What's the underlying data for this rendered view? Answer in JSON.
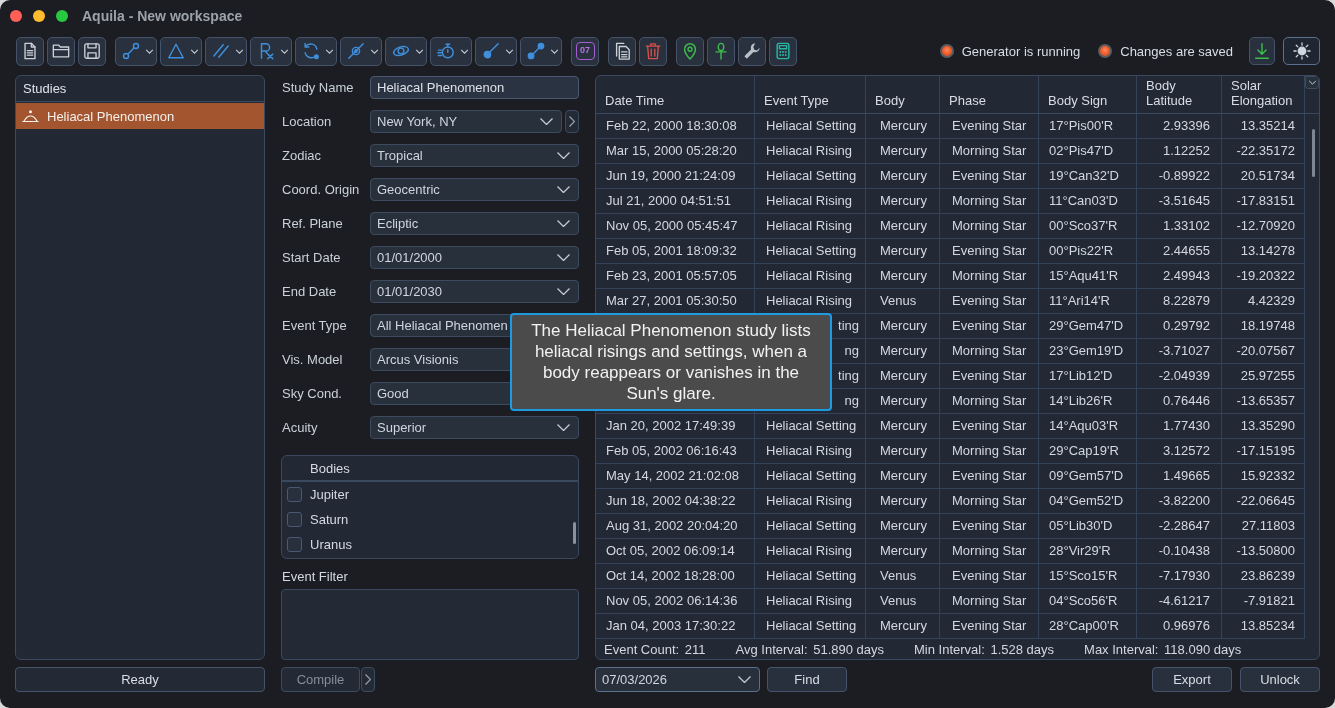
{
  "window": {
    "title": "Aquila - New workspace"
  },
  "toolbar": {
    "calendar_day": "07",
    "statuses": [
      {
        "label": "Generator is running"
      },
      {
        "label": "Changes are saved"
      }
    ]
  },
  "studies": {
    "title": "Studies",
    "items": [
      {
        "label": "Heliacal Phenomenon",
        "selected": true
      }
    ],
    "status": "Ready"
  },
  "form": {
    "fields": [
      {
        "label": "Study Name",
        "value": "Heliacal Phenomenon",
        "kind": "text"
      },
      {
        "label": "Location",
        "value": "New York, NY",
        "kind": "dropdown-link"
      },
      {
        "label": "Zodiac",
        "value": "Tropical",
        "kind": "dropdown"
      },
      {
        "label": "Coord. Origin",
        "value": "Geocentric",
        "kind": "dropdown"
      },
      {
        "label": "Ref. Plane",
        "value": "Ecliptic",
        "kind": "dropdown"
      },
      {
        "label": "Start Date",
        "value": "01/01/2000",
        "kind": "dropdown"
      },
      {
        "label": "End Date",
        "value": "01/01/2030",
        "kind": "dropdown"
      },
      {
        "label": "Event Type",
        "value": "All Heliacal Phenomen",
        "kind": "obscured"
      },
      {
        "label": "Vis. Model",
        "value": "Arcus Visionis",
        "kind": "obscured"
      },
      {
        "label": "Sky Cond.",
        "value": "Good",
        "kind": "obscured"
      },
      {
        "label": "Acuity",
        "value": "Superior",
        "kind": "dropdown"
      }
    ]
  },
  "bodies": {
    "title": "Bodies",
    "items": [
      {
        "label": "Jupiter",
        "checked": false
      },
      {
        "label": "Saturn",
        "checked": false
      },
      {
        "label": "Uranus",
        "checked": false
      }
    ]
  },
  "event_filter": {
    "label": "Event Filter"
  },
  "compile_button": {
    "label": "Compile",
    "disabled": true
  },
  "table": {
    "columns": [
      "Date Time",
      "Event Type",
      "Body",
      "Phase",
      "Body Sign",
      "Body Latitude",
      "Solar Elongation"
    ],
    "rows": [
      {
        "date_time": "Feb 22, 2000 18:30:08",
        "event_type": "Heliacal Setting",
        "body": "Mercury",
        "phase": "Evening Star",
        "body_sign": "17°Pis00'R",
        "body_latitude": "2.93396",
        "solar_elongation": "13.35214",
        "under_tooltip": false
      },
      {
        "date_time": "Mar 15, 2000 05:28:20",
        "event_type": "Heliacal Rising",
        "body": "Mercury",
        "phase": "Morning Star",
        "body_sign": "02°Pis47'D",
        "body_latitude": "1.12252",
        "solar_elongation": "-22.35172",
        "under_tooltip": false
      },
      {
        "date_time": "Jun 19, 2000 21:24:09",
        "event_type": "Heliacal Setting",
        "body": "Mercury",
        "phase": "Evening Star",
        "body_sign": "19°Can32'D",
        "body_latitude": "-0.89922",
        "solar_elongation": "20.51734",
        "under_tooltip": false
      },
      {
        "date_time": "Jul 21, 2000 04:51:51",
        "event_type": "Heliacal Rising",
        "body": "Mercury",
        "phase": "Morning Star",
        "body_sign": "11°Can03'D",
        "body_latitude": "-3.51645",
        "solar_elongation": "-17.83151",
        "under_tooltip": false
      },
      {
        "date_time": "Nov 05, 2000 05:45:47",
        "event_type": "Heliacal Rising",
        "body": "Mercury",
        "phase": "Morning Star",
        "body_sign": "00°Sco37'R",
        "body_latitude": "1.33102",
        "solar_elongation": "-12.70920",
        "under_tooltip": false
      },
      {
        "date_time": "Feb 05, 2001 18:09:32",
        "event_type": "Heliacal Setting",
        "body": "Mercury",
        "phase": "Evening Star",
        "body_sign": "00°Pis22'R",
        "body_latitude": "2.44655",
        "solar_elongation": "13.14278",
        "under_tooltip": false
      },
      {
        "date_time": "Feb 23, 2001 05:57:05",
        "event_type": "Heliacal Rising",
        "body": "Mercury",
        "phase": "Morning Star",
        "body_sign": "15°Aqu41'R",
        "body_latitude": "2.49943",
        "solar_elongation": "-19.20322",
        "under_tooltip": false
      },
      {
        "date_time": "Mar 27, 2001 05:30:50",
        "event_type": "Heliacal Rising",
        "body": "Venus",
        "phase": "Evening Star",
        "body_sign": "11°Ari14'R",
        "body_latitude": "8.22879",
        "solar_elongation": "4.42329",
        "under_tooltip": false
      },
      {
        "event_type": "ting",
        "body": "Mercury",
        "phase": "Evening Star",
        "body_sign": "29°Gem47'D",
        "body_latitude": "0.29792",
        "solar_elongation": "18.19748",
        "under_tooltip": true
      },
      {
        "event_type": "ng",
        "body": "Mercury",
        "phase": "Morning Star",
        "body_sign": "23°Gem19'D",
        "body_latitude": "-3.71027",
        "solar_elongation": "-20.07567",
        "under_tooltip": true
      },
      {
        "event_type": "ting",
        "body": "Mercury",
        "phase": "Evening Star",
        "body_sign": "17°Lib12'D",
        "body_latitude": "-2.04939",
        "solar_elongation": "25.97255",
        "under_tooltip": true
      },
      {
        "event_type": "ng",
        "body": "Mercury",
        "phase": "Morning Star",
        "body_sign": "14°Lib26'R",
        "body_latitude": "0.76446",
        "solar_elongation": "-13.65357",
        "under_tooltip": true
      },
      {
        "date_time": "Jan 20, 2002 17:49:39",
        "event_type": "Heliacal Setting",
        "body": "Mercury",
        "phase": "Evening Star",
        "body_sign": "14°Aqu03'R",
        "body_latitude": "1.77430",
        "solar_elongation": "13.35290",
        "under_tooltip": false
      },
      {
        "date_time": "Feb 05, 2002 06:16:43",
        "event_type": "Heliacal Rising",
        "body": "Mercury",
        "phase": "Morning Star",
        "body_sign": "29°Cap19'R",
        "body_latitude": "3.12572",
        "solar_elongation": "-17.15195",
        "under_tooltip": false
      },
      {
        "date_time": "May 14, 2002 21:02:08",
        "event_type": "Heliacal Setting",
        "body": "Mercury",
        "phase": "Evening Star",
        "body_sign": "09°Gem57'D",
        "body_latitude": "1.49665",
        "solar_elongation": "15.92332",
        "under_tooltip": false
      },
      {
        "date_time": "Jun 18, 2002 04:38:22",
        "event_type": "Heliacal Rising",
        "body": "Mercury",
        "phase": "Morning Star",
        "body_sign": "04°Gem52'D",
        "body_latitude": "-3.82200",
        "solar_elongation": "-22.06645",
        "under_tooltip": false
      },
      {
        "date_time": "Aug 31, 2002 20:04:20",
        "event_type": "Heliacal Setting",
        "body": "Mercury",
        "phase": "Evening Star",
        "body_sign": "05°Lib30'D",
        "body_latitude": "-2.28647",
        "solar_elongation": "27.11803",
        "under_tooltip": false
      },
      {
        "date_time": "Oct 05, 2002 06:09:14",
        "event_type": "Heliacal Rising",
        "body": "Mercury",
        "phase": "Morning Star",
        "body_sign": "28°Vir29'R",
        "body_latitude": "-0.10438",
        "solar_elongation": "-13.50800",
        "under_tooltip": false
      },
      {
        "date_time": "Oct 14, 2002 18:28:00",
        "event_type": "Heliacal Setting",
        "body": "Venus",
        "phase": "Evening Star",
        "body_sign": "15°Sco15'R",
        "body_latitude": "-7.17930",
        "solar_elongation": "23.86239",
        "under_tooltip": false
      },
      {
        "date_time": "Nov 05, 2002 06:14:36",
        "event_type": "Heliacal Rising",
        "body": "Venus",
        "phase": "Morning Star",
        "body_sign": "04°Sco56'R",
        "body_latitude": "-4.61217",
        "solar_elongation": "-7.91821",
        "under_tooltip": false
      },
      {
        "date_time": "Jan 04, 2003 17:30:22",
        "event_type": "Heliacal Setting",
        "body": "Mercury",
        "phase": "Evening Star",
        "body_sign": "28°Cap00'R",
        "body_latitude": "0.96976",
        "solar_elongation": "13.85234",
        "under_tooltip": false
      }
    ],
    "summary": [
      {
        "label": "Event Count:",
        "value": "211"
      },
      {
        "label": "Avg Interval:",
        "value": "51.890 days"
      },
      {
        "label": "Min Interval:",
        "value": "1.528 days"
      },
      {
        "label": "Max Interval:",
        "value": "118.090 days"
      }
    ]
  },
  "bottom_bar": {
    "date": "07/03/2026",
    "find": "Find",
    "actions": [
      "Export",
      "Unlock"
    ]
  },
  "tooltip": {
    "text": "The Heliacal Phenomenon study lists heliacal risings and settings, when a body reappears or vanishes in the Sun's glare."
  }
}
